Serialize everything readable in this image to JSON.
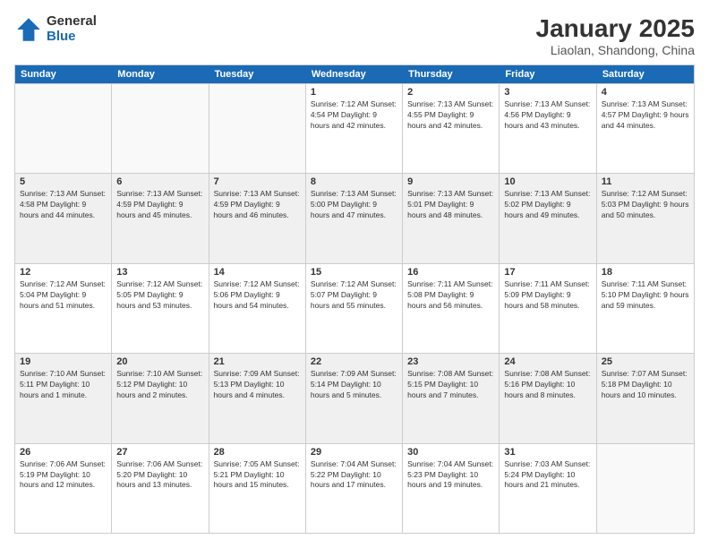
{
  "logo": {
    "general": "General",
    "blue": "Blue"
  },
  "title": "January 2025",
  "location": "Liaolan, Shandong, China",
  "weekdays": [
    "Sunday",
    "Monday",
    "Tuesday",
    "Wednesday",
    "Thursday",
    "Friday",
    "Saturday"
  ],
  "rows": [
    [
      {
        "day": "",
        "text": "",
        "empty": true
      },
      {
        "day": "",
        "text": "",
        "empty": true
      },
      {
        "day": "",
        "text": "",
        "empty": true
      },
      {
        "day": "1",
        "text": "Sunrise: 7:12 AM\nSunset: 4:54 PM\nDaylight: 9 hours and 42 minutes."
      },
      {
        "day": "2",
        "text": "Sunrise: 7:13 AM\nSunset: 4:55 PM\nDaylight: 9 hours and 42 minutes."
      },
      {
        "day": "3",
        "text": "Sunrise: 7:13 AM\nSunset: 4:56 PM\nDaylight: 9 hours and 43 minutes."
      },
      {
        "day": "4",
        "text": "Sunrise: 7:13 AM\nSunset: 4:57 PM\nDaylight: 9 hours and 44 minutes."
      }
    ],
    [
      {
        "day": "5",
        "text": "Sunrise: 7:13 AM\nSunset: 4:58 PM\nDaylight: 9 hours and 44 minutes.",
        "shaded": true
      },
      {
        "day": "6",
        "text": "Sunrise: 7:13 AM\nSunset: 4:59 PM\nDaylight: 9 hours and 45 minutes.",
        "shaded": true
      },
      {
        "day": "7",
        "text": "Sunrise: 7:13 AM\nSunset: 4:59 PM\nDaylight: 9 hours and 46 minutes.",
        "shaded": true
      },
      {
        "day": "8",
        "text": "Sunrise: 7:13 AM\nSunset: 5:00 PM\nDaylight: 9 hours and 47 minutes.",
        "shaded": true
      },
      {
        "day": "9",
        "text": "Sunrise: 7:13 AM\nSunset: 5:01 PM\nDaylight: 9 hours and 48 minutes.",
        "shaded": true
      },
      {
        "day": "10",
        "text": "Sunrise: 7:13 AM\nSunset: 5:02 PM\nDaylight: 9 hours and 49 minutes.",
        "shaded": true
      },
      {
        "day": "11",
        "text": "Sunrise: 7:12 AM\nSunset: 5:03 PM\nDaylight: 9 hours and 50 minutes.",
        "shaded": true
      }
    ],
    [
      {
        "day": "12",
        "text": "Sunrise: 7:12 AM\nSunset: 5:04 PM\nDaylight: 9 hours and 51 minutes."
      },
      {
        "day": "13",
        "text": "Sunrise: 7:12 AM\nSunset: 5:05 PM\nDaylight: 9 hours and 53 minutes."
      },
      {
        "day": "14",
        "text": "Sunrise: 7:12 AM\nSunset: 5:06 PM\nDaylight: 9 hours and 54 minutes."
      },
      {
        "day": "15",
        "text": "Sunrise: 7:12 AM\nSunset: 5:07 PM\nDaylight: 9 hours and 55 minutes."
      },
      {
        "day": "16",
        "text": "Sunrise: 7:11 AM\nSunset: 5:08 PM\nDaylight: 9 hours and 56 minutes."
      },
      {
        "day": "17",
        "text": "Sunrise: 7:11 AM\nSunset: 5:09 PM\nDaylight: 9 hours and 58 minutes."
      },
      {
        "day": "18",
        "text": "Sunrise: 7:11 AM\nSunset: 5:10 PM\nDaylight: 9 hours and 59 minutes."
      }
    ],
    [
      {
        "day": "19",
        "text": "Sunrise: 7:10 AM\nSunset: 5:11 PM\nDaylight: 10 hours and 1 minute.",
        "shaded": true
      },
      {
        "day": "20",
        "text": "Sunrise: 7:10 AM\nSunset: 5:12 PM\nDaylight: 10 hours and 2 minutes.",
        "shaded": true
      },
      {
        "day": "21",
        "text": "Sunrise: 7:09 AM\nSunset: 5:13 PM\nDaylight: 10 hours and 4 minutes.",
        "shaded": true
      },
      {
        "day": "22",
        "text": "Sunrise: 7:09 AM\nSunset: 5:14 PM\nDaylight: 10 hours and 5 minutes.",
        "shaded": true
      },
      {
        "day": "23",
        "text": "Sunrise: 7:08 AM\nSunset: 5:15 PM\nDaylight: 10 hours and 7 minutes.",
        "shaded": true
      },
      {
        "day": "24",
        "text": "Sunrise: 7:08 AM\nSunset: 5:16 PM\nDaylight: 10 hours and 8 minutes.",
        "shaded": true
      },
      {
        "day": "25",
        "text": "Sunrise: 7:07 AM\nSunset: 5:18 PM\nDaylight: 10 hours and 10 minutes.",
        "shaded": true
      }
    ],
    [
      {
        "day": "26",
        "text": "Sunrise: 7:06 AM\nSunset: 5:19 PM\nDaylight: 10 hours and 12 minutes."
      },
      {
        "day": "27",
        "text": "Sunrise: 7:06 AM\nSunset: 5:20 PM\nDaylight: 10 hours and 13 minutes."
      },
      {
        "day": "28",
        "text": "Sunrise: 7:05 AM\nSunset: 5:21 PM\nDaylight: 10 hours and 15 minutes."
      },
      {
        "day": "29",
        "text": "Sunrise: 7:04 AM\nSunset: 5:22 PM\nDaylight: 10 hours and 17 minutes."
      },
      {
        "day": "30",
        "text": "Sunrise: 7:04 AM\nSunset: 5:23 PM\nDaylight: 10 hours and 19 minutes."
      },
      {
        "day": "31",
        "text": "Sunrise: 7:03 AM\nSunset: 5:24 PM\nDaylight: 10 hours and 21 minutes."
      },
      {
        "day": "",
        "text": "",
        "empty": true
      }
    ]
  ]
}
